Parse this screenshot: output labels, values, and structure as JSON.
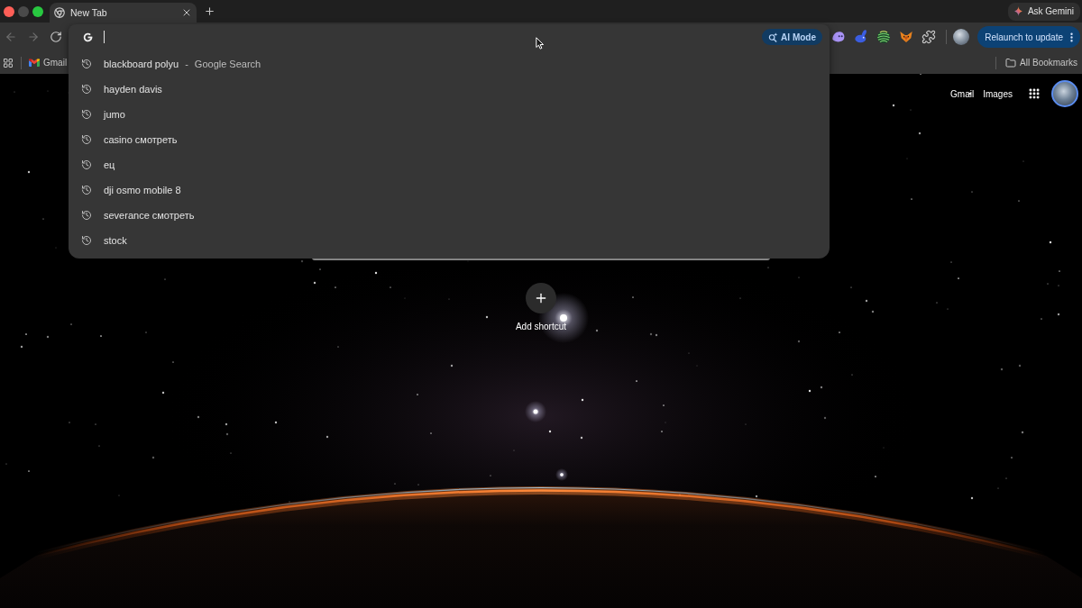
{
  "tab_strip": {
    "tabs": [
      {
        "title": "New Tab",
        "selected": true
      }
    ],
    "ask_gemini": "Ask Gemini"
  },
  "toolbar": {
    "nav_buttons": [
      {
        "kind": "back",
        "disabled": true
      },
      {
        "kind": "forward",
        "disabled": true
      },
      {
        "kind": "reload",
        "disabled": false
      }
    ],
    "ai_mode": "AI Mode",
    "relaunch": "Relaunch to update"
  },
  "omnibox_suggestions": [
    {
      "text": "blackboard polyu",
      "separator": "-",
      "description": "Google Search"
    },
    {
      "text": "hayden davis"
    },
    {
      "text": "jumo"
    },
    {
      "text": "casino смотреть"
    },
    {
      "text": "ец"
    },
    {
      "text": "dji osmo mobile 8"
    },
    {
      "text": "severance смотреть"
    },
    {
      "text": "stock"
    }
  ],
  "bookmarks_bar": {
    "bookmarks": [
      {
        "label": "Gmail"
      }
    ],
    "all_bookmarks": "All Bookmarks"
  },
  "new_tab_page": {
    "header_links": [
      "Gmail",
      "Images"
    ],
    "add_shortcut": "Add shortcut"
  }
}
